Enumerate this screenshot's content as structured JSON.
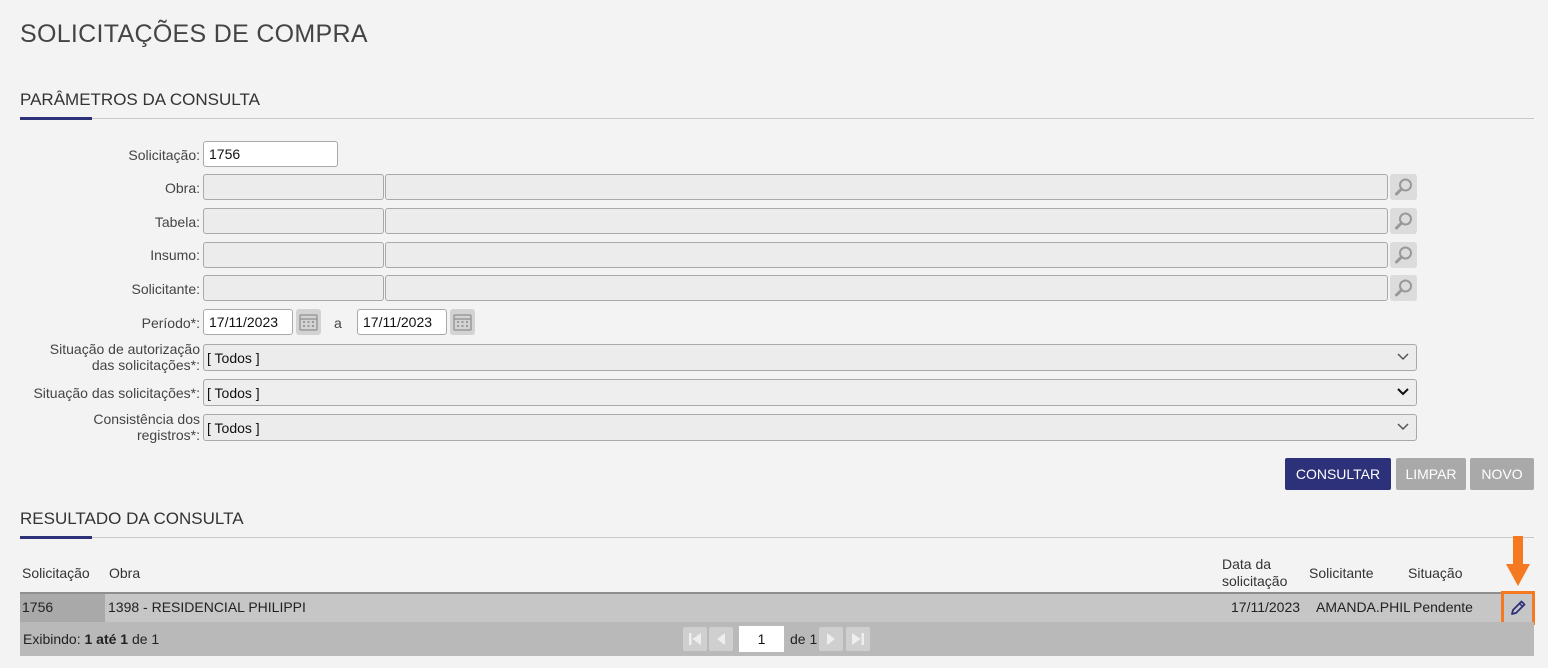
{
  "page": {
    "title": "SOLICITAÇÕES DE COMPRA"
  },
  "params": {
    "heading": "PARÂMETROS DA CONSULTA",
    "solicitacao": {
      "label": "Solicitação:",
      "value": "1756"
    },
    "obra": {
      "label": "Obra:",
      "code": "",
      "desc": ""
    },
    "tabela": {
      "label": "Tabela:",
      "code": "",
      "desc": ""
    },
    "insumo": {
      "label": "Insumo:",
      "code": "",
      "desc": ""
    },
    "solicitante": {
      "label": "Solicitante:",
      "code": "",
      "desc": ""
    },
    "periodo": {
      "label": "Período*:",
      "from": "17/11/2023",
      "sep": "a",
      "to": "17/11/2023"
    },
    "situacao_autorizacao": {
      "label_line1": "Situação de autorização",
      "label_line2": "das solicitações*:",
      "value": "[ Todos ]"
    },
    "situacao_solicitacoes": {
      "label": "Situação das solicitações*:",
      "value": "[ Todos ]"
    },
    "consistencia": {
      "label_line1": "Consistência dos",
      "label_line2": "registros*:",
      "value": "[ Todos ]"
    }
  },
  "buttons": {
    "consultar": "CONSULTAR",
    "limpar": "LIMPAR",
    "novo": "NOVO"
  },
  "results": {
    "heading": "RESULTADO DA CONSULTA",
    "columns": {
      "solicitacao": "Solicitação",
      "obra": "Obra",
      "data_line1": "Data da",
      "data_line2": "solicitação",
      "solicitante": "Solicitante",
      "situacao": "Situação"
    },
    "rows": [
      {
        "solicitacao": "1756",
        "obra": "1398 - RESIDENCIAL PHILIPPI",
        "data": "17/11/2023",
        "solicitante": "AMANDA.PHIL",
        "situacao": "Pendente",
        "action_icon": "pencil-icon"
      }
    ],
    "footer": {
      "prefix": "Exibindo: ",
      "range": "1 até 1",
      "suffix": " de 1",
      "page": "1",
      "of_label": "de 1"
    }
  },
  "colors": {
    "primary": "#2c3179",
    "highlight": "#f47920",
    "disabled": "#a9a9a9"
  }
}
